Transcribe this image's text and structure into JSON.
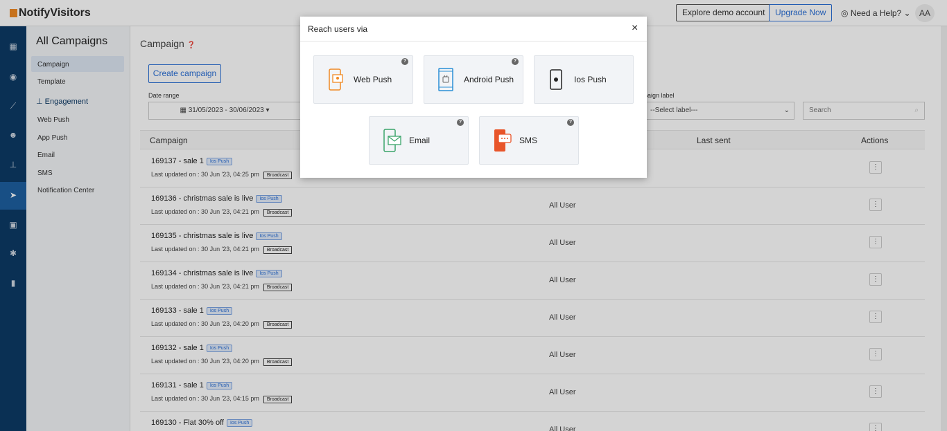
{
  "brand": {
    "name": "NotifyVisitors"
  },
  "topbar": {
    "explore": "Explore demo account",
    "upgrade": "Upgrade Now",
    "help": "Need a Help?",
    "avatar": "AA"
  },
  "sidebar": {
    "title": "All Campaigns",
    "items": [
      {
        "label": "Campaign"
      },
      {
        "label": "Template"
      }
    ],
    "section": "Engagement",
    "engagement_items": [
      {
        "label": "Web Push"
      },
      {
        "label": "App Push"
      },
      {
        "label": "Email"
      },
      {
        "label": "SMS"
      },
      {
        "label": "Notification Center"
      }
    ]
  },
  "main": {
    "title": "Campaign",
    "create_label": "Create campaign",
    "date_label": "Date range",
    "date_value": "31/05/2023 - 30/06/2023",
    "campaign_label_partial": "paign label",
    "select_placeholder": "--Select label---",
    "search_placeholder": "Search",
    "columns": {
      "campaign": "Campaign",
      "last_sent": "Last sent",
      "actions": "Actions"
    }
  },
  "rows": [
    {
      "name": "169137 - sale 1",
      "tag": "Ios Push",
      "updated": "Last updated on : 30 Jun '23, 04:25 pm",
      "type": "Broadcast",
      "audience": ""
    },
    {
      "name": "169136 - christmas sale is live",
      "tag": "Ios Push",
      "updated": "Last updated on : 30 Jun '23, 04:21 pm",
      "type": "Broadcast",
      "audience": "All User"
    },
    {
      "name": "169135 - christmas sale is live",
      "tag": "Ios Push",
      "updated": "Last updated on : 30 Jun '23, 04:21 pm",
      "type": "Broadcast",
      "audience": "All User"
    },
    {
      "name": "169134 - christmas sale is live",
      "tag": "Ios Push",
      "updated": "Last updated on : 30 Jun '23, 04:21 pm",
      "type": "Broadcast",
      "audience": "All User"
    },
    {
      "name": "169133 - sale 1",
      "tag": "Ios Push",
      "updated": "Last updated on : 30 Jun '23, 04:20 pm",
      "type": "Broadcast",
      "audience": "All User"
    },
    {
      "name": "169132 - sale 1",
      "tag": "Ios Push",
      "updated": "Last updated on : 30 Jun '23, 04:20 pm",
      "type": "Broadcast",
      "audience": "All User"
    },
    {
      "name": "169131 - sale 1",
      "tag": "Ios Push",
      "updated": "Last updated on : 30 Jun '23, 04:15 pm",
      "type": "Broadcast",
      "audience": "All User"
    },
    {
      "name": "169130 - Flat 30% off",
      "tag": "Ios Push",
      "updated": "",
      "type": "",
      "audience": "All User"
    }
  ],
  "modal": {
    "title": "Reach users via",
    "options": [
      {
        "label": "Web Push"
      },
      {
        "label": "Android Push"
      },
      {
        "label": "Ios Push"
      },
      {
        "label": "Email"
      },
      {
        "label": "SMS"
      }
    ]
  },
  "colors": {
    "accent": "#2a6fd6",
    "nav": "#0d3a66",
    "web_push": "#f08a24",
    "android": "#2a8fd6",
    "email": "#3aa36a",
    "sms": "#e8552a"
  }
}
